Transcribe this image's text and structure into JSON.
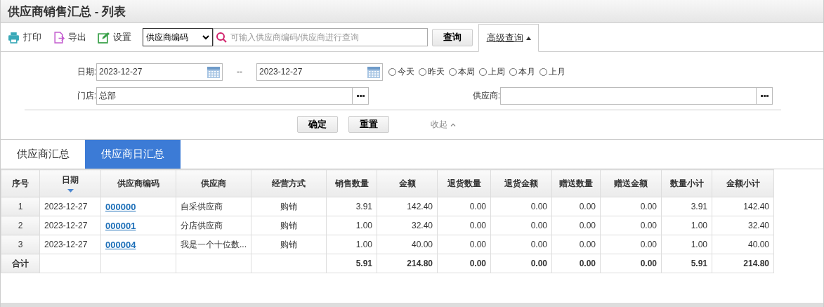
{
  "window": {
    "title": "供应商销售汇总 - 列表"
  },
  "toolbar": {
    "actions": [
      {
        "kind": "print",
        "label": "打印"
      },
      {
        "kind": "export",
        "label": "导出"
      },
      {
        "kind": "settings",
        "label": "设置"
      }
    ],
    "search_type": "供应商编码",
    "search": {
      "placeholder": "可输入供应商编码/供应商进行查询"
    },
    "query_button": "查询",
    "advanced": {
      "label": "高级查询",
      "expanded": true
    }
  },
  "filters": {
    "date_label": "日期:",
    "date_from": "2023-12-27",
    "separator": "--",
    "date_to": "2023-12-27",
    "ranges": [
      {
        "label": "今天",
        "selected": false
      },
      {
        "label": "昨天",
        "selected": false
      },
      {
        "label": "本周",
        "selected": false
      },
      {
        "label": "上周",
        "selected": false
      },
      {
        "label": "本月",
        "selected": false
      },
      {
        "label": "上月",
        "selected": false
      }
    ],
    "store_label": "门店:",
    "store": "总部",
    "supplier_label": "供应商:",
    "buttons": [
      "确定",
      "重置"
    ],
    "collapse": "收起"
  },
  "tabs": [
    {
      "label": "供应商汇总",
      "selected": false
    },
    {
      "label": "供应商日汇总",
      "selected": true
    }
  ],
  "table": {
    "columns": [
      {
        "label": "序号",
        "kind": "index",
        "sorted": false
      },
      {
        "label": "日期",
        "kind": "text",
        "sorted": true
      },
      {
        "label": "供应商编码",
        "kind": "link",
        "sorted": false
      },
      {
        "label": "供应商",
        "kind": "text",
        "sorted": false
      },
      {
        "label": "经营方式",
        "kind": "center",
        "sorted": false
      },
      {
        "label": "销售数量",
        "kind": "number",
        "sorted": false
      },
      {
        "label": "金额",
        "kind": "number",
        "sorted": false
      },
      {
        "label": "退货数量",
        "kind": "number",
        "sorted": false
      },
      {
        "label": "退货金额",
        "kind": "number",
        "sorted": false
      },
      {
        "label": "赠送数量",
        "kind": "number",
        "sorted": false
      },
      {
        "label": "赠送金额",
        "kind": "number",
        "sorted": false
      },
      {
        "label": "数量小计",
        "kind": "number",
        "sorted": false
      },
      {
        "label": "金额小计",
        "kind": "number",
        "sorted": false
      }
    ],
    "rows": [
      [
        "1",
        "2023-12-27",
        "000000",
        "自采供应商",
        "购销",
        "3.91",
        "142.40",
        "0.00",
        "0.00",
        "0.00",
        "0.00",
        "3.91",
        "142.40"
      ],
      [
        "2",
        "2023-12-27",
        "000001",
        "分店供应商",
        "购销",
        "1.00",
        "32.40",
        "0.00",
        "0.00",
        "0.00",
        "0.00",
        "1.00",
        "32.40"
      ],
      [
        "3",
        "2023-12-27",
        "000004",
        "我是一个十位数...",
        "购销",
        "1.00",
        "40.00",
        "0.00",
        "0.00",
        "0.00",
        "0.00",
        "1.00",
        "40.00"
      ]
    ],
    "totals": {
      "label": "合计",
      "values": [
        "5.91",
        "214.80",
        "0.00",
        "0.00",
        "0.00",
        "0.00",
        "5.91",
        "214.80"
      ]
    }
  }
}
